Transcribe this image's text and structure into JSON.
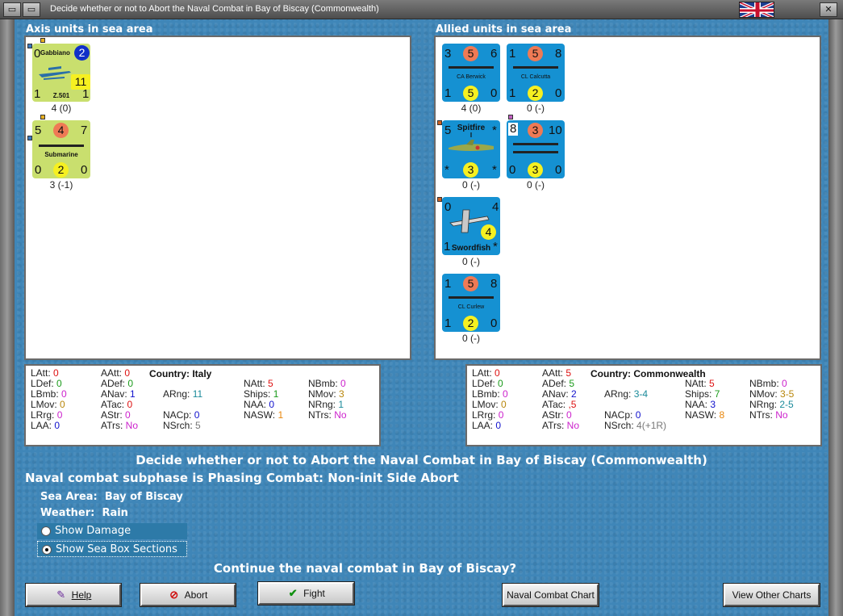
{
  "window": {
    "title": "Decide whether or not to Abort the Naval Combat in Bay of Biscay (Commonwealth)",
    "min_icon": "minimize-icon",
    "close_icon": "close-icon",
    "flag": "union-jack-flag"
  },
  "axis": {
    "header": "Axis units in sea area",
    "units": [
      {
        "tl": "0",
        "tr": "2",
        "name": "Gabbiano",
        "sub": "Z.501",
        "mid": "11",
        "bl": "1",
        "br": "1",
        "label": "4 (0)",
        "kind": "air"
      },
      {
        "tl": "5",
        "tc": "4",
        "tr": "7",
        "name": "Submarine",
        "bl": "0",
        "bc": "2",
        "br": "0",
        "label": "3 (-1)",
        "kind": "sub"
      }
    ]
  },
  "allied": {
    "header": "Allied units in sea area",
    "units": [
      {
        "tl": "3",
        "tc": "5",
        "tr": "6",
        "name": "CA Berwick",
        "bl": "1",
        "bc": "5",
        "br": "0",
        "label": "4 (0)",
        "kind": "ship"
      },
      {
        "tl": "1",
        "tc": "5",
        "tr": "8",
        "name": "CL Calcutta",
        "bl": "1",
        "bc": "2",
        "br": "0",
        "label": "0 (-)",
        "kind": "ship"
      },
      {
        "tl": "5",
        "name": "Spitfire",
        "sub": "I",
        "tr": "*",
        "bl": "*",
        "bc": "3",
        "br": "*",
        "label": "0 (-)",
        "kind": "air"
      },
      {
        "tl": "8",
        "tc": "3",
        "tr": "10",
        "bl": "0",
        "bc": "3",
        "br": "0",
        "label": "0 (-)",
        "kind": "convoy"
      },
      {
        "tl": "0",
        "tr": "4",
        "mid": "4",
        "name": "Swordfish",
        "bl": "1",
        "br": "*",
        "label": "0 (-)",
        "kind": "air"
      },
      {
        "tl": "1",
        "tc": "5",
        "tr": "8",
        "name": "CL Curlew",
        "bl": "1",
        "bc": "2",
        "br": "0",
        "label": "0 (-)",
        "kind": "ship"
      }
    ]
  },
  "axis_stats": {
    "country_label": "Country:",
    "country": "Italy",
    "rows": [
      {
        "k": "LAtt:",
        "v": "0",
        "c": "#d11"
      },
      {
        "k": "LDef:",
        "v": "0",
        "c": "#1a9a1a"
      },
      {
        "k": "LBmb:",
        "v": "0",
        "c": "#c2c"
      },
      {
        "k": "LMov:",
        "v": "0",
        "c": "#b8860b"
      },
      {
        "k": "LRrg:",
        "v": "0",
        "c": "#c2c"
      },
      {
        "k": "LAA:",
        "v": "0",
        "c": "#11c"
      },
      {
        "k": "AAtt:",
        "v": "0",
        "c": "#d11"
      },
      {
        "k": "ADef:",
        "v": "0",
        "c": "#1a9a1a"
      },
      {
        "k": "ANav:",
        "v": "1",
        "c": "#11c"
      },
      {
        "k": "ATac:",
        "v": "0",
        "c": "#d11"
      },
      {
        "k": "AStr:",
        "v": "0",
        "c": "#c2c"
      },
      {
        "k": "ATrs:",
        "v": "No",
        "c": "#c2c"
      },
      {
        "k": "ARng:",
        "v": "11",
        "c": "#1a8a9a"
      },
      {
        "k": "NACp:",
        "v": "0",
        "c": "#11c"
      },
      {
        "k": "NSrch:",
        "v": "5",
        "c": "#777"
      },
      {
        "k": "NAtt:",
        "v": "5",
        "c": "#d11"
      },
      {
        "k": "Ships:",
        "v": "1",
        "c": "#1a9a1a"
      },
      {
        "k": "NAA:",
        "v": "0",
        "c": "#11c"
      },
      {
        "k": "NASW:",
        "v": "1",
        "c": "#e8860b"
      },
      {
        "k": "NBmb:",
        "v": "0",
        "c": "#c2c"
      },
      {
        "k": "NMov:",
        "v": "3",
        "c": "#b8860b"
      },
      {
        "k": "NRng:",
        "v": "1",
        "c": "#1a8a9a"
      },
      {
        "k": "NTrs:",
        "v": "No",
        "c": "#c2c"
      }
    ]
  },
  "allied_stats": {
    "country_label": "Country:",
    "country": "Commonwealth",
    "rows": [
      {
        "k": "LAtt:",
        "v": "0",
        "c": "#d11"
      },
      {
        "k": "LDef:",
        "v": "0",
        "c": "#1a9a1a"
      },
      {
        "k": "LBmb:",
        "v": "0",
        "c": "#c2c"
      },
      {
        "k": "LMov:",
        "v": "0",
        "c": "#b8860b"
      },
      {
        "k": "LRrg:",
        "v": "0",
        "c": "#c2c"
      },
      {
        "k": "LAA:",
        "v": "0",
        "c": "#11c"
      },
      {
        "k": "AAtt:",
        "v": "5",
        "c": "#d11"
      },
      {
        "k": "ADef:",
        "v": "5",
        "c": "#1a9a1a"
      },
      {
        "k": "ANav:",
        "v": "2",
        "c": "#11c"
      },
      {
        "k": "ATac:",
        "v": ",5",
        "c": "#d11"
      },
      {
        "k": "AStr:",
        "v": "0",
        "c": "#c2c"
      },
      {
        "k": "ATrs:",
        "v": "No",
        "c": "#c2c"
      },
      {
        "k": "ARng:",
        "v": "3-4",
        "c": "#1a8a9a"
      },
      {
        "k": "NACp:",
        "v": "0",
        "c": "#11c"
      },
      {
        "k": "NSrch:",
        "v": "4(+1R)",
        "c": "#777"
      },
      {
        "k": "NAtt:",
        "v": "5",
        "c": "#d11"
      },
      {
        "k": "Ships:",
        "v": "7",
        "c": "#1a9a1a"
      },
      {
        "k": "NAA:",
        "v": "3",
        "c": "#11c"
      },
      {
        "k": "NASW:",
        "v": "8",
        "c": "#e8860b"
      },
      {
        "k": "NBmb:",
        "v": "0",
        "c": "#c2c"
      },
      {
        "k": "NMov:",
        "v": "3-5",
        "c": "#b8860b"
      },
      {
        "k": "NRng:",
        "v": "2-5",
        "c": "#1a8a9a"
      },
      {
        "k": "NTrs:",
        "v": "No",
        "c": "#c2c"
      }
    ]
  },
  "messages": {
    "headline": "Decide whether or not to Abort the Naval Combat in Bay of Biscay (Commonwealth)",
    "subphase": "Naval combat subphase is Phasing Combat: Non-init Side Abort",
    "sea_area_label": "Sea Area:",
    "sea_area": "Bay of Biscay",
    "weather_label": "Weather:",
    "weather": "Rain",
    "question": "Continue the naval combat in Bay of Biscay?"
  },
  "options": {
    "show_damage": {
      "label": "Show Damage",
      "checked": false
    },
    "show_sea_box": {
      "label": "Show Sea Box Sections",
      "checked": true
    }
  },
  "buttons": {
    "help": "Help",
    "abort": "Abort",
    "fight": "Fight",
    "naval_chart": "Naval Combat Chart",
    "other_charts": "View Other Charts"
  }
}
